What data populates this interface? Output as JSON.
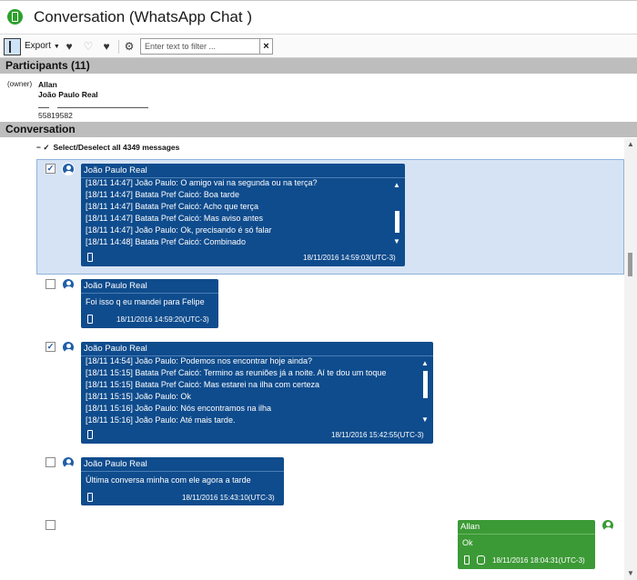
{
  "window": {
    "title": "Conversation (WhatsApp Chat )"
  },
  "toolbar": {
    "export_label": "Export",
    "filter_placeholder": "Enter text to filter ...",
    "clear_label": "×"
  },
  "participants": {
    "header": "Participants (11)",
    "owner_label": "(owner)",
    "names": [
      "Allan",
      "João Paulo Real"
    ],
    "number": "55819582"
  },
  "conversation": {
    "header": "Conversation",
    "select_all": "Select/Deselect all 4349 messages",
    "messages": [
      {
        "sender": "João Paulo Real",
        "checked": true,
        "lines": [
          "[18/11 14:47] João Paulo: O amigo vai na segunda ou na terça?",
          "[18/11 14:47] Batata Pref Caicó: Boa tarde",
          "[18/11 14:47] Batata Pref Caicó: Acho que terça",
          "[18/11 14:47] Batata Pref Caicó: Mas aviso antes",
          "[18/11 14:47] João Paulo: Ok, precisando é só falar",
          "[18/11 14:48] Batata Pref Caicó: Combinado"
        ],
        "timestamp": "18/11/2016 14:59:03(UTC-3)"
      },
      {
        "sender": "João Paulo Real",
        "checked": false,
        "lines": [
          "Foi isso q eu mandei para Felipe"
        ],
        "timestamp": "18/11/2016 14:59:20(UTC-3)"
      },
      {
        "sender": "João Paulo Real",
        "checked": true,
        "lines": [
          "[18/11 14:54] João Paulo: Podemos nos encontrar hoje ainda?",
          "[18/11 15:15] Batata Pref Caicó: Termino as reuniões já a noite. Aí te dou um toque",
          "[18/11 15:15] Batata Pref Caicó: Mas estarei na ilha com certeza",
          "[18/11 15:15] João Paulo: Ok",
          "[18/11 15:16] João Paulo: Nós encontramos na ilha",
          "[18/11 15:16] João Paulo: Até mais tarde."
        ],
        "timestamp": "18/11/2016 15:42:55(UTC-3)"
      },
      {
        "sender": "João Paulo Real",
        "checked": false,
        "lines": [
          "Última conversa minha com ele agora a tarde"
        ],
        "timestamp": "18/11/2016 15:43:10(UTC-3)"
      },
      {
        "sender": "Allan",
        "checked": false,
        "lines": [
          "Ok"
        ],
        "timestamp": "18/11/2016 18:04:31(UTC-3)"
      }
    ]
  },
  "colors": {
    "incoming_bubble": "#0f4c8d",
    "outgoing_bubble": "#3c9a36",
    "section_header": "#bdbdbd",
    "selected_row": "#d6e3f4"
  },
  "icons": [
    "panel-toggle-icon",
    "bookmark-add-icon",
    "bookmark-remove-icon",
    "bookmark-settings-icon",
    "gear-icon",
    "phone-icon",
    "chevron-up-icon",
    "chevron-down-icon",
    "avatar-icon"
  ]
}
